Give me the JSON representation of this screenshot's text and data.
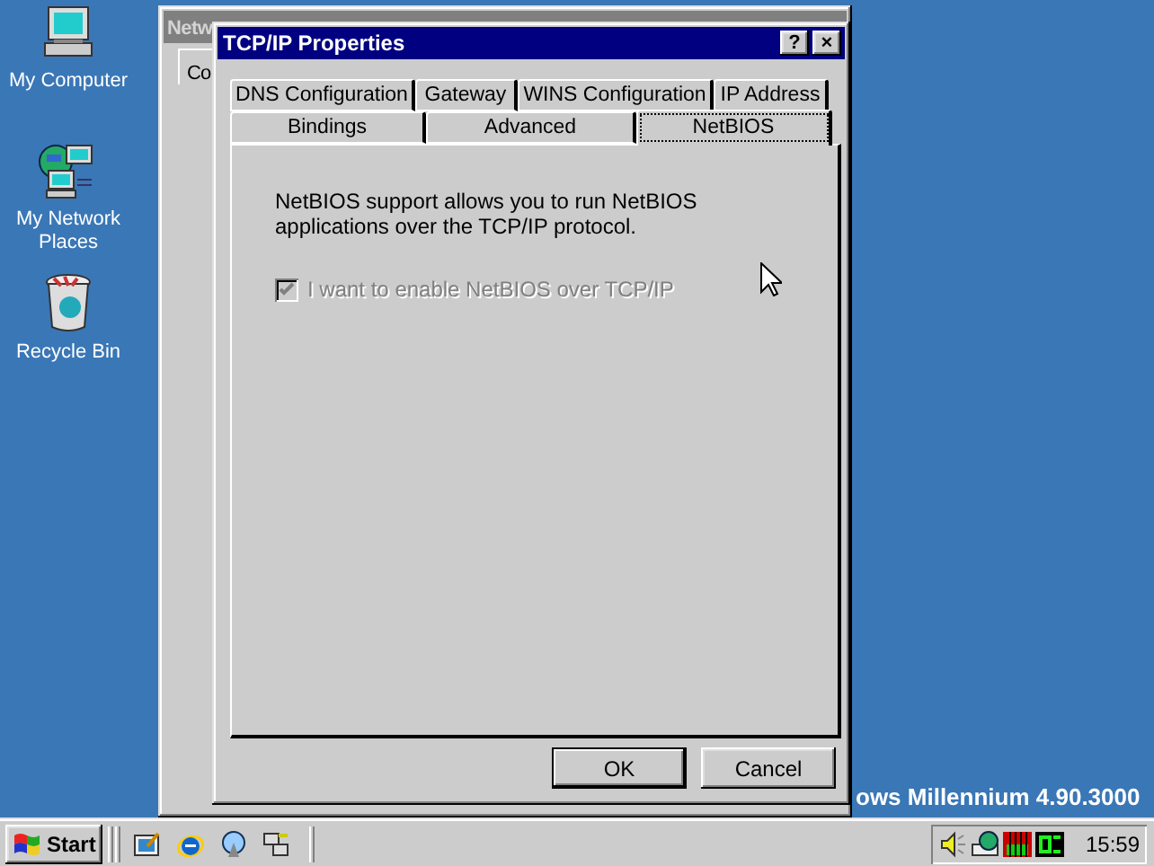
{
  "desktop_icons": [
    {
      "kind": "computer",
      "label": "My Computer"
    },
    {
      "kind": "network",
      "label": "My Network Places"
    },
    {
      "kind": "recycle-bin",
      "label": "Recycle Bin"
    }
  ],
  "background_window": {
    "title": "Netw",
    "tab": "Co"
  },
  "dialog": {
    "title": "TCP/IP Properties",
    "title_buttons": [
      "?",
      "×"
    ],
    "tab_rows": [
      [
        {
          "label": "DNS Configuration",
          "selected": false
        },
        {
          "label": "Gateway",
          "selected": false
        },
        {
          "label": "WINS Configuration",
          "selected": false
        },
        {
          "label": "IP Address",
          "selected": false
        }
      ],
      [
        {
          "label": "Bindings",
          "selected": false
        },
        {
          "label": "Advanced",
          "selected": false
        },
        {
          "label": "NetBIOS",
          "selected": true
        }
      ]
    ],
    "description": "NetBIOS support allows you to run NetBIOS applications over the TCP/IP protocol.",
    "checkbox": {
      "label": "I want to enable NetBIOS over TCP/IP",
      "checked": true,
      "disabled": true
    },
    "buttons": [
      "OK",
      "Cancel"
    ]
  },
  "desktop_text": "ows Millennium 4.90.3000",
  "taskbar": {
    "start": "Start",
    "clock": "15:59"
  }
}
